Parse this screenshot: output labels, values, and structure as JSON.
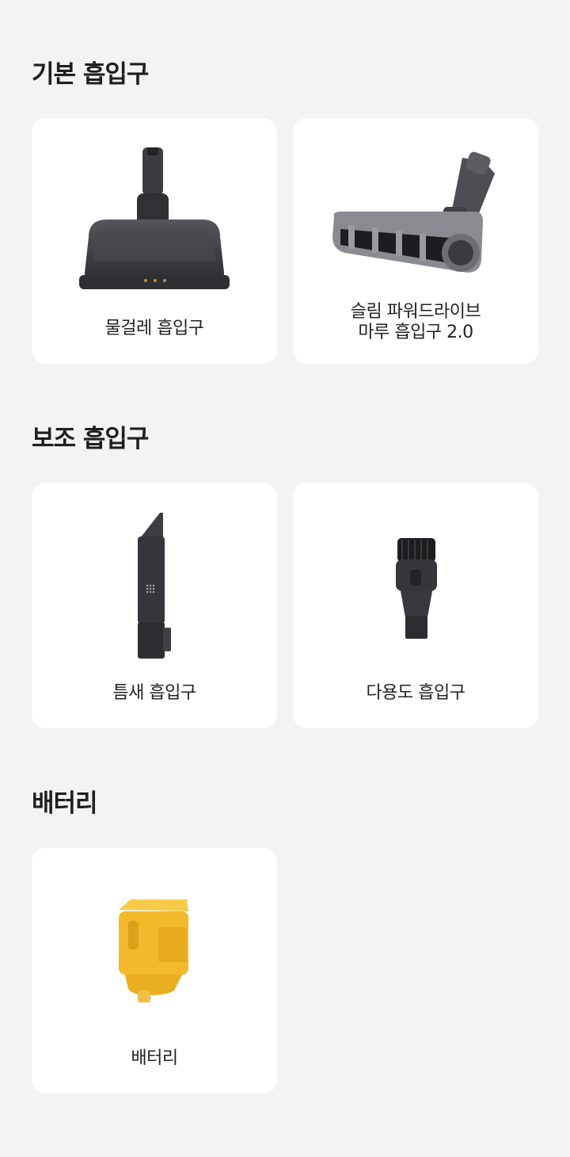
{
  "sections": [
    {
      "title": "기본 흡입구",
      "items": [
        {
          "label": "물걸레 흡입구",
          "icon": "mop-nozzle-icon"
        },
        {
          "label": "슬림 파워드라이브\n마루 흡입구 2.0",
          "icon": "slim-powerdrive-floor-nozzle-icon"
        }
      ]
    },
    {
      "title": "보조 흡입구",
      "items": [
        {
          "label": "틈새 흡입구",
          "icon": "crevice-nozzle-icon"
        },
        {
          "label": "다용도 흡입구",
          "icon": "multi-purpose-brush-icon"
        }
      ]
    },
    {
      "title": "배터리",
      "items": [
        {
          "label": "배터리",
          "icon": "battery-pack-icon"
        }
      ]
    }
  ],
  "colors": {
    "background": "#f3f3f3",
    "card": "#ffffff",
    "nozzle_dark": "#3a3b3f",
    "battery_yellow": "#f2b92b"
  }
}
